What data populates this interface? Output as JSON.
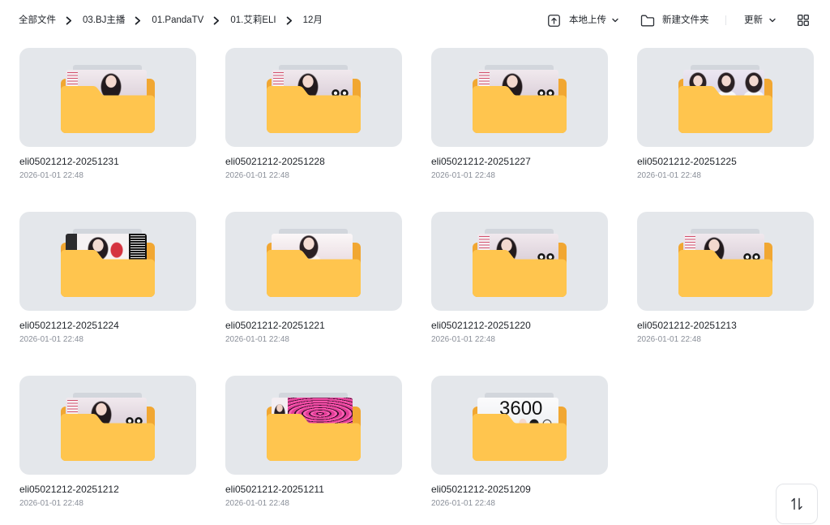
{
  "breadcrumb": [
    {
      "label": "全部文件"
    },
    {
      "label": "03.BJ主播"
    },
    {
      "label": "01.PandaTV"
    },
    {
      "label": "01.艾莉ELI"
    },
    {
      "label": "12月"
    }
  ],
  "toolbar": {
    "upload": {
      "label": "本地上传",
      "icon": "upload-icon"
    },
    "new_folder": {
      "label": "新建文件夹",
      "icon": "folder-outline-icon"
    },
    "sort": {
      "label": "更新",
      "icon": "chevron-down-icon"
    },
    "view_toggle": {
      "icon": "grid-view-icon"
    }
  },
  "files": [
    {
      "name": "eli05021212-20251231",
      "modified": "2026-01-01 22:48",
      "icon": "folder-icon"
    },
    {
      "name": "eli05021212-20251228",
      "modified": "2026-01-01 22:48",
      "icon": "folder-icon"
    },
    {
      "name": "eli05021212-20251227",
      "modified": "2026-01-01 22:48",
      "icon": "folder-icon"
    },
    {
      "name": "eli05021212-20251225",
      "modified": "2026-01-01 22:48",
      "icon": "folder-icon"
    },
    {
      "name": "eli05021212-20251224",
      "modified": "2026-01-01 22:48",
      "icon": "folder-icon"
    },
    {
      "name": "eli05021212-20251221",
      "modified": "2026-01-01 22:48",
      "icon": "folder-icon"
    },
    {
      "name": "eli05021212-20251220",
      "modified": "2026-01-01 22:48",
      "icon": "folder-icon"
    },
    {
      "name": "eli05021212-20251213",
      "modified": "2026-01-01 22:48",
      "icon": "folder-icon"
    },
    {
      "name": "eli05021212-20251212",
      "modified": "2026-01-01 22:48",
      "icon": "folder-icon"
    },
    {
      "name": "eli05021212-20251211",
      "modified": "2026-01-01 22:48",
      "icon": "folder-icon"
    },
    {
      "name": "eli05021212-20251209",
      "modified": "2026-01-01 22:48",
      "icon": "folder-icon",
      "thumb_text": "3600"
    }
  ],
  "floating_action": {
    "icon": "sort-arrows-icon"
  },
  "colors": {
    "folder_front": "#FFC54E",
    "folder_back": "#F1A732",
    "card_background": "#E4E7EB"
  }
}
